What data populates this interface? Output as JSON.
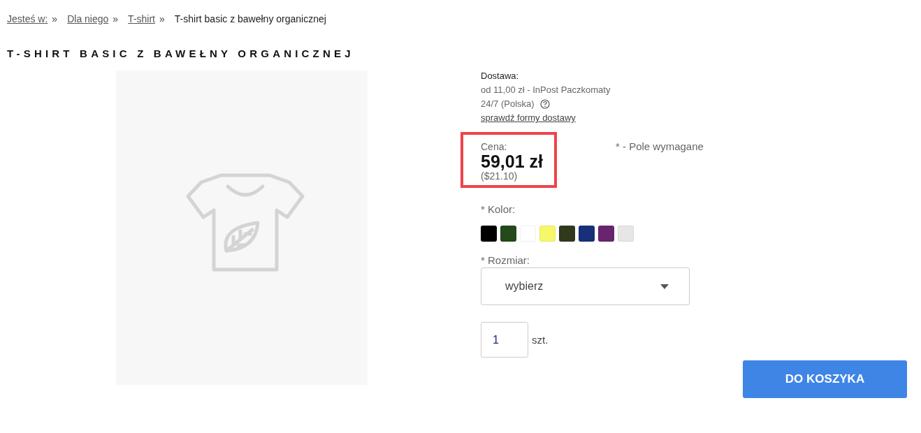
{
  "breadcrumb": {
    "prefix": "Jesteś w:",
    "items": [
      {
        "separator": "»",
        "label": "Dla niego",
        "link": true
      },
      {
        "separator": "»",
        "label": "T-shirt",
        "link": true
      },
      {
        "separator": "»",
        "label": "T-shirt basic z bawełny organicznej",
        "link": false
      }
    ]
  },
  "product": {
    "title": "T-SHIRT BASIC Z BAWEŁNY ORGANICZNEJ",
    "delivery": {
      "label": "Dostawa:",
      "line_1": "od 11,00 zł - InPost Paczkomaty",
      "line_2": "24/7 (Polska)",
      "link": "sprawdź formy dostawy"
    },
    "price": {
      "label": "Cena:",
      "value": "59,01 zł",
      "alt_currency": "($21.10)"
    },
    "required_note": "* - Pole wymagane",
    "color": {
      "label": "* Kolor:",
      "swatches": [
        {
          "color": "#000000"
        },
        {
          "color": "#224a1a"
        },
        {
          "color": "#ffffff"
        },
        {
          "color": "#f7f76a"
        },
        {
          "color": "#2f3a1d"
        },
        {
          "color": "#16307a"
        },
        {
          "color": "#69246f"
        },
        {
          "color": "#e6e6e6"
        }
      ]
    },
    "size": {
      "label": "* Rozmiar:",
      "value": "wybierz"
    },
    "quantity": {
      "value": "1",
      "unit": "szt."
    },
    "add_to_cart": "DO KOSZYKA"
  }
}
